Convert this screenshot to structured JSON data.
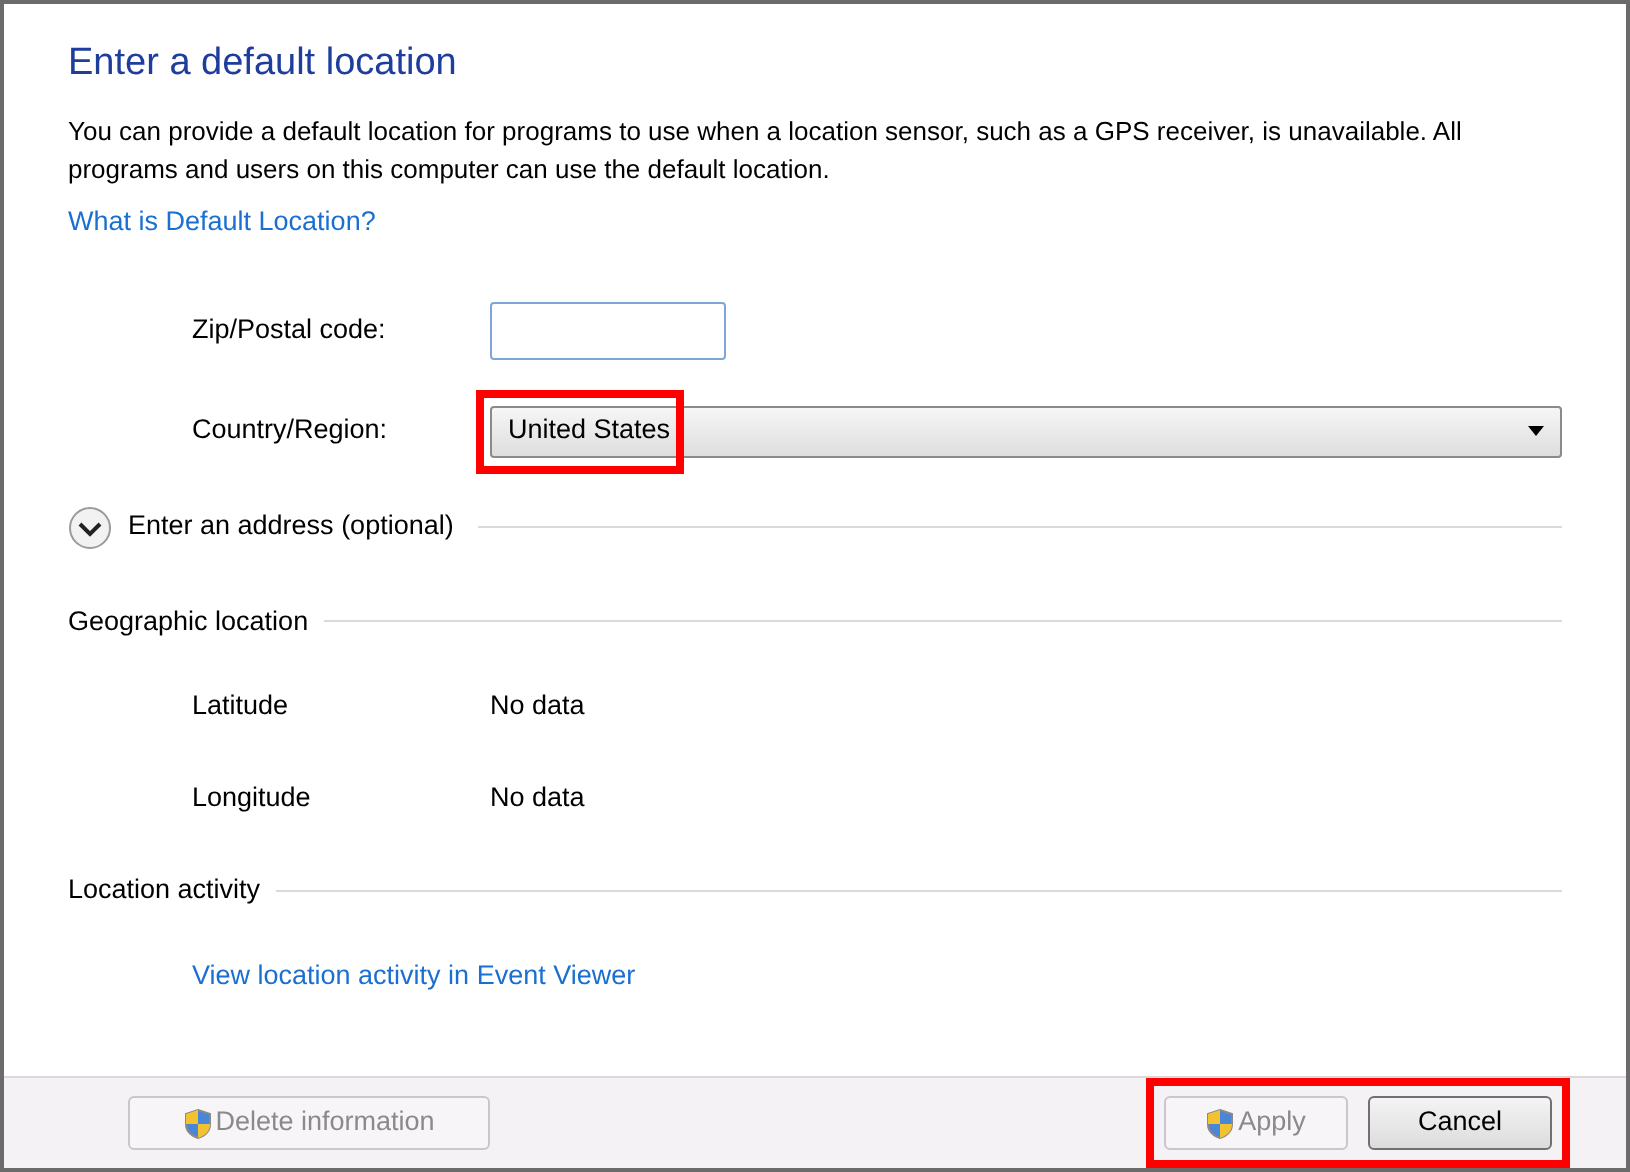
{
  "title": "Enter a default location",
  "description": "You can provide a default location for programs to use when a location sensor, such as a GPS receiver, is unavailable. All programs and users on this computer can use the default location.",
  "help_link": "What is Default Location?",
  "fields": [
    {
      "kind": "text",
      "label": "Zip/Postal code:",
      "highlighted": false
    },
    {
      "kind": "dropdown",
      "label": "Country/Region:",
      "value": "United States",
      "highlighted": true
    }
  ],
  "address_section": {
    "label": "Enter an address (optional)",
    "expanded": false
  },
  "geographic_location": {
    "heading": "Geographic location",
    "rows": [
      {
        "label": "Latitude",
        "value": "No data"
      },
      {
        "label": "Longitude",
        "value": "No data"
      }
    ]
  },
  "location_activity": {
    "heading": "Location activity",
    "link": "View location activity in Event Viewer"
  },
  "footer": {
    "left_button": {
      "label": "Delete information",
      "disabled": true,
      "shield": true
    },
    "right_buttons": [
      {
        "label": "Apply",
        "disabled": true,
        "shield": true
      },
      {
        "label": "Cancel",
        "disabled": false,
        "shield": false
      }
    ],
    "right_highlighted": true
  }
}
